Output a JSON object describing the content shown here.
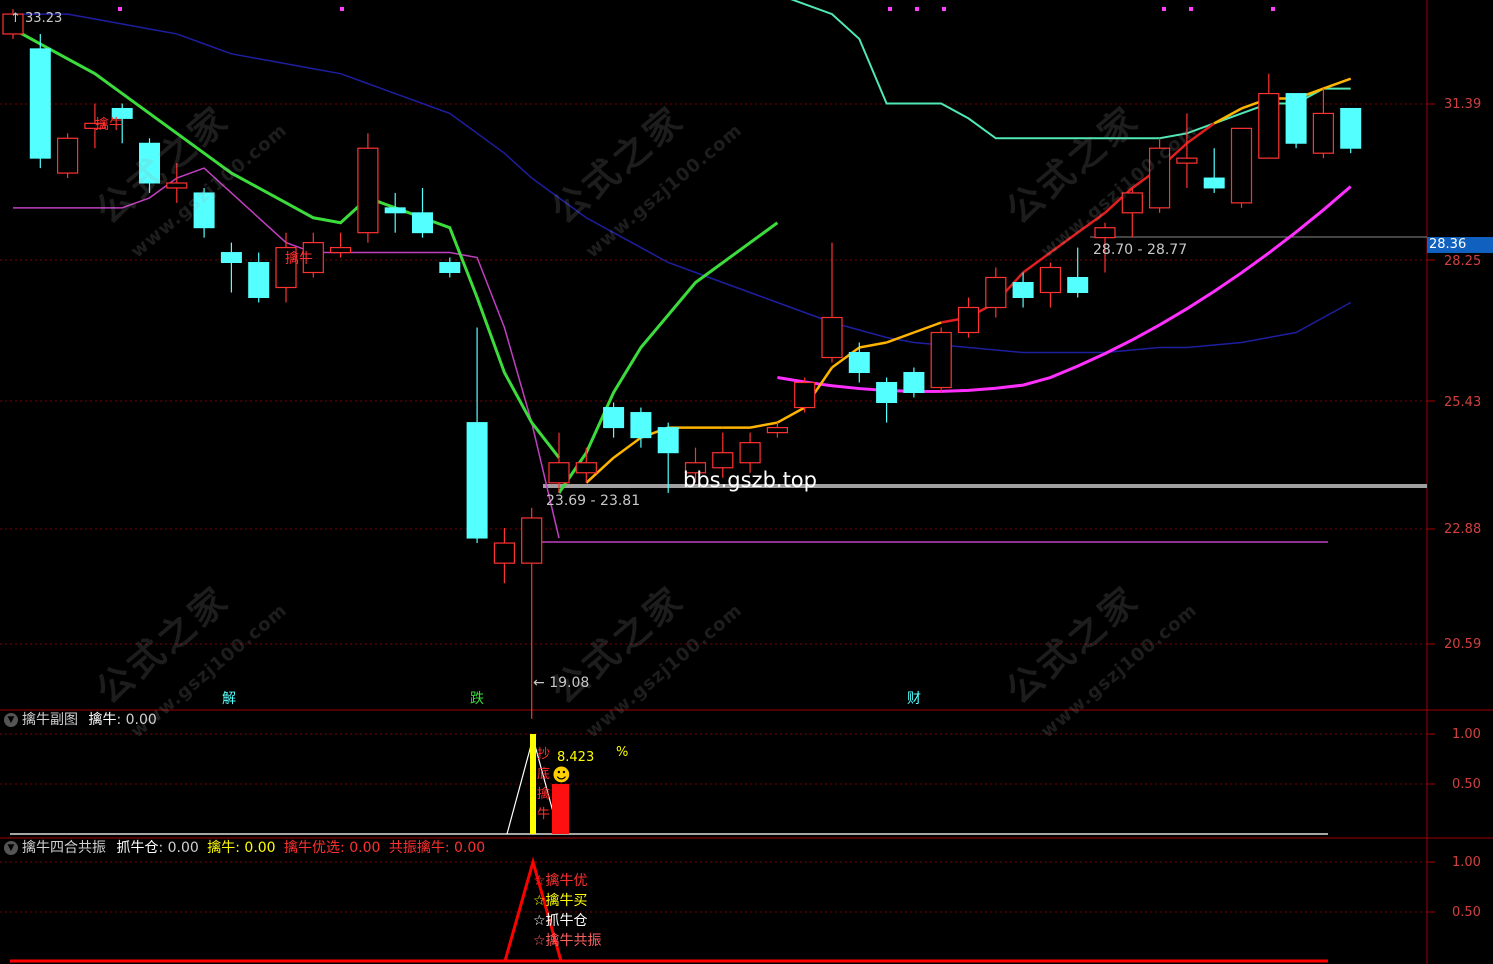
{
  "main": {
    "label_33": "33.23",
    "prices": {
      "p1": "31.39",
      "p2": "28.25",
      "p3": "25.43",
      "p4": "22.88",
      "p5": "20.59"
    },
    "current_price": "28.36",
    "label_2870": "28.70 - 28.77",
    "label_2369": "23.69 - 23.81",
    "label_low": "19.08",
    "bbs": "bbs.gszb.top",
    "sig_1": "擒牛",
    "sig_2": "擒牛",
    "marker_1": "解",
    "marker_2": "跌",
    "marker_3": "财",
    "watermark_cn": "公式之家",
    "watermark_url": "www.gszj100.com"
  },
  "sub1": {
    "title": "擒牛副图",
    "item_label": "擒牛",
    "item_value": ": 0.00",
    "y_top": "1.00",
    "y_mid": "0.50",
    "val_label": "8.423",
    "pct": "%",
    "vchars": [
      "抄",
      "底",
      "擒",
      "牛"
    ]
  },
  "sub2": {
    "title": "擒牛四合共振",
    "items": [
      {
        "label": "抓牛仓",
        "value": ": 0.00",
        "color": "#ffffff"
      },
      {
        "label": "擒牛",
        "value": ": 0.00",
        "color": "#ffff00"
      },
      {
        "label": "擒牛优选",
        "value": ": 0.00",
        "color": "#ff3030"
      },
      {
        "label": "共振擒牛",
        "value": ": 0.00",
        "color": "#ff3030"
      }
    ],
    "y_top": "1.00",
    "y_mid": "0.50",
    "legend": [
      {
        "text": "☆擒牛优",
        "color": "#ff3030"
      },
      {
        "text": "☆擒牛买",
        "color": "#ffff00"
      },
      {
        "text": "☆抓牛仓",
        "color": "#ffffff"
      },
      {
        "text": "☆擒牛共振",
        "color": "#ff6060"
      }
    ]
  },
  "colors": {
    "up": "#ff3232",
    "down": "#54ffff",
    "grid": "#8b0000",
    "ma_green": "#3cdc3c",
    "ma_blue": "#1e1ea0",
    "ma_magenta": "#ff30ff",
    "ma_teal": "#50e8b4",
    "ma_yellow": "#ffb400"
  },
  "chart_data": {
    "type": "candlestick",
    "y_ticks": [
      31.39,
      28.25,
      25.43,
      22.88,
      20.59
    ],
    "current_price": 28.36,
    "candles": [
      {
        "o": 32.8,
        "c": 33.2,
        "h": 33.3,
        "l": 32.7
      },
      {
        "o": 32.5,
        "c": 30.3,
        "h": 32.8,
        "l": 30.1
      },
      {
        "o": 30.0,
        "c": 30.7,
        "h": 30.8,
        "l": 29.9
      },
      {
        "o": 30.9,
        "c": 31.0,
        "h": 31.4,
        "l": 30.5
      },
      {
        "o": 31.3,
        "c": 31.1,
        "h": 31.4,
        "l": 30.6
      },
      {
        "o": 30.6,
        "c": 29.8,
        "h": 30.7,
        "l": 29.6
      },
      {
        "o": 29.7,
        "c": 29.8,
        "h": 30.2,
        "l": 29.4
      },
      {
        "o": 29.6,
        "c": 28.9,
        "h": 29.7,
        "l": 28.7
      },
      {
        "o": 28.4,
        "c": 28.2,
        "h": 28.6,
        "l": 27.6
      },
      {
        "o": 28.2,
        "c": 27.5,
        "h": 28.4,
        "l": 27.4
      },
      {
        "o": 27.7,
        "c": 28.5,
        "h": 28.8,
        "l": 27.4
      },
      {
        "o": 28.0,
        "c": 28.6,
        "h": 28.8,
        "l": 27.9
      },
      {
        "o": 28.4,
        "c": 28.5,
        "h": 28.8,
        "l": 28.3
      },
      {
        "o": 28.8,
        "c": 30.5,
        "h": 30.8,
        "l": 28.6
      },
      {
        "o": 29.3,
        "c": 29.2,
        "h": 29.6,
        "l": 28.8
      },
      {
        "o": 29.2,
        "c": 28.8,
        "h": 29.7,
        "l": 28.7
      },
      {
        "o": 28.2,
        "c": 28.0,
        "h": 28.3,
        "l": 27.9
      },
      {
        "o": 25.0,
        "c": 22.7,
        "h": 26.9,
        "l": 22.6
      },
      {
        "o": 22.2,
        "c": 22.6,
        "h": 22.9,
        "l": 21.8
      },
      {
        "o": 22.2,
        "c": 23.1,
        "h": 23.3,
        "l": 19.1
      },
      {
        "o": 23.8,
        "c": 24.2,
        "h": 24.8,
        "l": 23.6
      },
      {
        "o": 24.0,
        "c": 24.2,
        "h": 24.5,
        "l": 23.8
      },
      {
        "o": 25.3,
        "c": 24.9,
        "h": 25.4,
        "l": 24.7
      },
      {
        "o": 25.2,
        "c": 24.7,
        "h": 25.3,
        "l": 24.5
      },
      {
        "o": 24.9,
        "c": 24.4,
        "h": 25.0,
        "l": 23.6
      },
      {
        "o": 24.0,
        "c": 24.2,
        "h": 24.5,
        "l": 23.8
      },
      {
        "o": 24.1,
        "c": 24.4,
        "h": 24.8,
        "l": 23.9
      },
      {
        "o": 24.2,
        "c": 24.6,
        "h": 24.8,
        "l": 24.0
      },
      {
        "o": 24.8,
        "c": 24.9,
        "h": 25.0,
        "l": 24.7
      },
      {
        "o": 25.3,
        "c": 25.8,
        "h": 25.9,
        "l": 25.2
      },
      {
        "o": 26.3,
        "c": 27.1,
        "h": 28.6,
        "l": 26.2
      },
      {
        "o": 26.4,
        "c": 26.0,
        "h": 26.6,
        "l": 25.8
      },
      {
        "o": 25.8,
        "c": 25.4,
        "h": 25.9,
        "l": 25.0
      },
      {
        "o": 26.0,
        "c": 25.6,
        "h": 26.1,
        "l": 25.5
      },
      {
        "o": 25.7,
        "c": 26.8,
        "h": 26.9,
        "l": 25.6
      },
      {
        "o": 26.8,
        "c": 27.3,
        "h": 27.5,
        "l": 26.7
      },
      {
        "o": 27.3,
        "c": 27.9,
        "h": 28.1,
        "l": 27.1
      },
      {
        "o": 27.8,
        "c": 27.5,
        "h": 28.0,
        "l": 27.3
      },
      {
        "o": 27.6,
        "c": 28.1,
        "h": 28.2,
        "l": 27.3
      },
      {
        "o": 27.9,
        "c": 27.6,
        "h": 28.5,
        "l": 27.5
      },
      {
        "o": 28.7,
        "c": 28.9,
        "h": 29.0,
        "l": 28.0
      },
      {
        "o": 29.2,
        "c": 29.6,
        "h": 29.7,
        "l": 28.7
      },
      {
        "o": 29.3,
        "c": 30.5,
        "h": 30.7,
        "l": 29.2
      },
      {
        "o": 30.2,
        "c": 30.3,
        "h": 31.2,
        "l": 29.7
      },
      {
        "o": 29.9,
        "c": 29.7,
        "h": 30.5,
        "l": 29.6
      },
      {
        "o": 29.4,
        "c": 30.9,
        "h": 30.9,
        "l": 29.3
      },
      {
        "o": 30.3,
        "c": 31.6,
        "h": 32.0,
        "l": 30.3
      },
      {
        "o": 31.6,
        "c": 30.6,
        "h": 31.6,
        "l": 30.5
      },
      {
        "o": 30.4,
        "c": 31.2,
        "h": 31.7,
        "l": 30.3
      },
      {
        "o": 31.3,
        "c": 30.5,
        "h": 31.3,
        "l": 30.4
      }
    ],
    "lines": {
      "green": [
        32.9,
        32.6,
        32.3,
        32.0,
        31.6,
        31.2,
        30.8,
        30.4,
        30.0,
        29.7,
        29.4,
        29.1,
        29.0,
        29.5,
        29.3,
        29.1,
        28.9,
        27.5,
        26.0,
        25.0,
        24.3,
        null,
        null,
        null,
        null,
        null,
        null,
        null,
        null,
        null
      ],
      "blue": [
        33.2,
        33.2,
        33.2,
        33.1,
        33.0,
        32.9,
        32.8,
        32.6,
        32.4,
        32.3,
        32.2,
        32.1,
        32.0,
        31.8,
        31.6,
        31.4,
        31.2,
        30.8,
        30.4,
        29.9,
        29.5,
        29.1,
        28.8,
        28.5,
        28.2,
        28.0,
        27.8,
        27.6,
        27.4,
        27.2,
        27.0,
        26.85,
        26.7,
        26.6,
        26.55,
        26.5,
        26.45,
        26.4,
        26.4,
        26.4,
        26.4,
        26.45,
        26.5,
        26.5,
        26.55,
        26.6,
        26.7,
        26.8,
        27.1,
        27.4
      ],
      "magenta": [
        29.3,
        29.3,
        29.3,
        29.3,
        29.3,
        29.5,
        29.9,
        30.1,
        29.6,
        29.1,
        28.6,
        28.4,
        28.4,
        28.4,
        28.4,
        28.4,
        28.4,
        28.3,
        26.9,
        25.0,
        22.7,
        22.7,
        22.7,
        22.7,
        22.7,
        22.7,
        22.7,
        22.7,
        22.7,
        22.7,
        22.7,
        22.7,
        22.7,
        22.7,
        22.7,
        22.7,
        22.7,
        22.7,
        22.7,
        22.7,
        22.7,
        22.7,
        22.7,
        22.7,
        22.7,
        22.7,
        22.7,
        22.7,
        22.7,
        22.7
      ],
      "teal_upper": [
        33.9,
        33.7,
        33.6,
        33.4,
        33.3,
        33.2,
        33.2,
        33.2,
        33.2,
        33.2,
        33.2,
        33.2,
        33.2,
        33.2,
        33.2,
        33.2,
        33.2,
        33.2,
        33.2,
        33.2,
        33.2,
        33.2,
        33.2,
        33.2,
        33.2,
        33.2,
        33.2,
        33.2,
        33.6,
        33.4,
        33.2,
        32.7,
        31.4,
        31.4,
        31.4,
        31.1,
        30.7,
        30.7,
        30.7,
        30.7,
        30.7,
        30.7,
        30.7,
        30.8,
        31.0,
        31.2,
        31.4,
        31.4,
        31.7,
        31.7
      ]
    }
  }
}
